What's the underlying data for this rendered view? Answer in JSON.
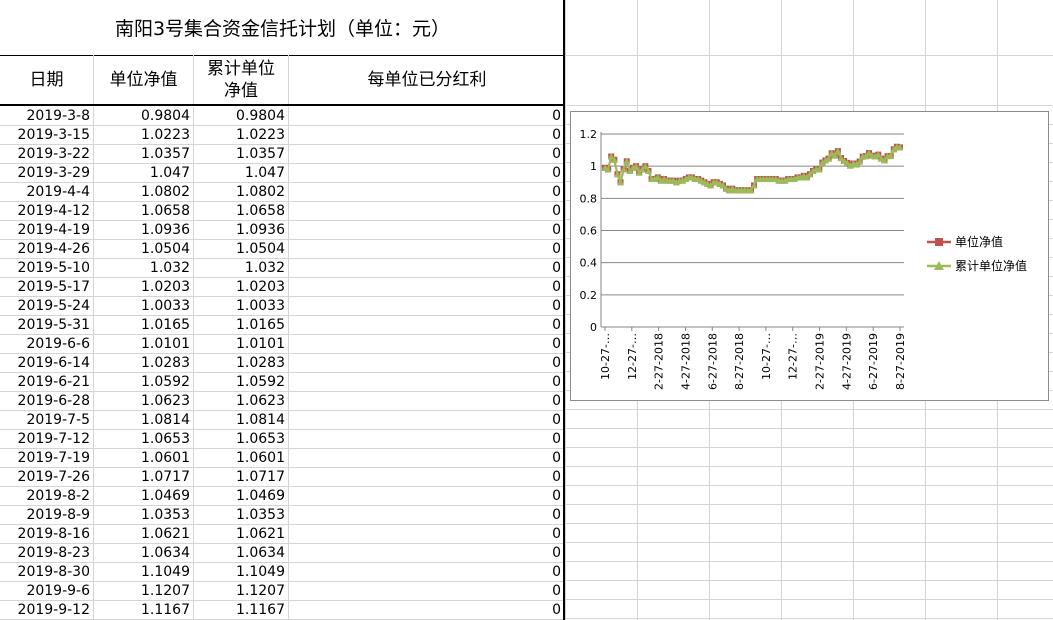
{
  "sheet": {
    "title": "南阳3号集合资金信托计划（单位：元）",
    "headers": {
      "date": "日期",
      "unit_nav": "单位净值",
      "cum_nav_line1": "累计单位",
      "cum_nav_line2": "净值",
      "dividend": "每单位已分红利"
    },
    "rows": [
      {
        "date": "2019-3-8",
        "nav": "0.9804",
        "cum": "0.9804",
        "div": "0"
      },
      {
        "date": "2019-3-15",
        "nav": "1.0223",
        "cum": "1.0223",
        "div": "0"
      },
      {
        "date": "2019-3-22",
        "nav": "1.0357",
        "cum": "1.0357",
        "div": "0"
      },
      {
        "date": "2019-3-29",
        "nav": "1.047",
        "cum": "1.047",
        "div": "0"
      },
      {
        "date": "2019-4-4",
        "nav": "1.0802",
        "cum": "1.0802",
        "div": "0"
      },
      {
        "date": "2019-4-12",
        "nav": "1.0658",
        "cum": "1.0658",
        "div": "0"
      },
      {
        "date": "2019-4-19",
        "nav": "1.0936",
        "cum": "1.0936",
        "div": "0"
      },
      {
        "date": "2019-4-26",
        "nav": "1.0504",
        "cum": "1.0504",
        "div": "0"
      },
      {
        "date": "2019-5-10",
        "nav": "1.032",
        "cum": "1.032",
        "div": "0"
      },
      {
        "date": "2019-5-17",
        "nav": "1.0203",
        "cum": "1.0203",
        "div": "0"
      },
      {
        "date": "2019-5-24",
        "nav": "1.0033",
        "cum": "1.0033",
        "div": "0"
      },
      {
        "date": "2019-5-31",
        "nav": "1.0165",
        "cum": "1.0165",
        "div": "0"
      },
      {
        "date": "2019-6-6",
        "nav": "1.0101",
        "cum": "1.0101",
        "div": "0"
      },
      {
        "date": "2019-6-14",
        "nav": "1.0283",
        "cum": "1.0283",
        "div": "0"
      },
      {
        "date": "2019-6-21",
        "nav": "1.0592",
        "cum": "1.0592",
        "div": "0"
      },
      {
        "date": "2019-6-28",
        "nav": "1.0623",
        "cum": "1.0623",
        "div": "0"
      },
      {
        "date": "2019-7-5",
        "nav": "1.0814",
        "cum": "1.0814",
        "div": "0"
      },
      {
        "date": "2019-7-12",
        "nav": "1.0653",
        "cum": "1.0653",
        "div": "0"
      },
      {
        "date": "2019-7-19",
        "nav": "1.0601",
        "cum": "1.0601",
        "div": "0"
      },
      {
        "date": "2019-7-26",
        "nav": "1.0717",
        "cum": "1.0717",
        "div": "0"
      },
      {
        "date": "2019-8-2",
        "nav": "1.0469",
        "cum": "1.0469",
        "div": "0"
      },
      {
        "date": "2019-8-9",
        "nav": "1.0353",
        "cum": "1.0353",
        "div": "0"
      },
      {
        "date": "2019-8-16",
        "nav": "1.0621",
        "cum": "1.0621",
        "div": "0"
      },
      {
        "date": "2019-8-23",
        "nav": "1.0634",
        "cum": "1.0634",
        "div": "0"
      },
      {
        "date": "2019-8-30",
        "nav": "1.1049",
        "cum": "1.1049",
        "div": "0"
      },
      {
        "date": "2019-9-6",
        "nav": "1.1207",
        "cum": "1.1207",
        "div": "0"
      },
      {
        "date": "2019-9-12",
        "nav": "1.1167",
        "cum": "1.1167",
        "div": "0"
      }
    ]
  },
  "chart_data": {
    "type": "line",
    "title": "",
    "xlabel": "",
    "ylabel": "",
    "ylim": [
      0,
      1.2
    ],
    "yticks": [
      "0",
      "0.2",
      "0.4",
      "0.6",
      "0.8",
      "1",
      "1.2"
    ],
    "xtick_labels": [
      "10-27-…",
      "12-27-…",
      "2-27-2018",
      "4-27-2018",
      "6-27-2018",
      "8-27-2018",
      "10-27-…",
      "12-27-…",
      "2-27-2019",
      "4-27-2019",
      "6-27-2019",
      "8-27-2019"
    ],
    "grid": true,
    "legend_position": "right",
    "x": [
      "2017-10-20",
      "2017-10-27",
      "2017-11-03",
      "2017-11-10",
      "2017-11-17",
      "2017-11-24",
      "2017-12-01",
      "2017-12-08",
      "2017-12-15",
      "2017-12-22",
      "2017-12-29",
      "2018-01-05",
      "2018-01-12",
      "2018-01-19",
      "2018-01-26",
      "2018-02-02",
      "2018-02-09",
      "2018-02-23",
      "2018-03-02",
      "2018-03-09",
      "2018-03-16",
      "2018-03-23",
      "2018-03-30",
      "2018-04-04",
      "2018-04-13",
      "2018-04-20",
      "2018-04-27",
      "2018-05-04",
      "2018-05-11",
      "2018-05-18",
      "2018-05-25",
      "2018-06-01",
      "2018-06-08",
      "2018-06-15",
      "2018-06-22",
      "2018-06-29",
      "2018-07-06",
      "2018-07-13",
      "2018-07-20",
      "2018-07-27",
      "2018-08-03",
      "2018-08-10",
      "2018-08-17",
      "2018-08-24",
      "2018-08-31",
      "2018-09-07",
      "2018-09-14",
      "2018-09-21",
      "2018-09-28",
      "2018-10-12",
      "2018-10-19",
      "2018-10-26",
      "2018-11-02",
      "2018-11-09",
      "2018-11-16",
      "2018-11-23",
      "2018-11-30",
      "2018-12-07",
      "2018-12-14",
      "2018-12-21",
      "2018-12-28",
      "2019-01-04",
      "2019-01-11",
      "2019-01-18",
      "2019-01-25",
      "2019-02-01",
      "2019-02-15",
      "2019-02-22",
      "2019-03-01",
      "2019-03-08",
      "2019-03-15",
      "2019-03-22",
      "2019-03-29",
      "2019-04-04",
      "2019-04-12",
      "2019-04-19",
      "2019-04-26",
      "2019-05-10",
      "2019-05-17",
      "2019-05-24",
      "2019-05-31",
      "2019-06-06",
      "2019-06-14",
      "2019-06-21",
      "2019-06-28",
      "2019-07-05",
      "2019-07-12",
      "2019-07-19",
      "2019-07-26",
      "2019-08-02",
      "2019-08-09",
      "2019-08-16",
      "2019-08-23",
      "2019-08-30",
      "2019-09-06",
      "2019-09-12"
    ],
    "series": [
      {
        "name": "单位净值",
        "color": "#c0504d",
        "marker": "square",
        "values": [
          0.99,
          0.98,
          1.06,
          1.04,
          0.95,
          0.9,
          0.98,
          1.03,
          0.97,
          0.99,
          1.0,
          0.96,
          0.98,
          1.0,
          0.97,
          0.92,
          0.92,
          0.93,
          0.91,
          0.92,
          0.91,
          0.91,
          0.91,
          0.9,
          0.91,
          0.91,
          0.92,
          0.93,
          0.93,
          0.92,
          0.92,
          0.91,
          0.9,
          0.89,
          0.88,
          0.9,
          0.9,
          0.89,
          0.88,
          0.86,
          0.85,
          0.86,
          0.85,
          0.85,
          0.85,
          0.85,
          0.85,
          0.85,
          0.88,
          0.92,
          0.92,
          0.92,
          0.92,
          0.92,
          0.92,
          0.92,
          0.91,
          0.91,
          0.91,
          0.92,
          0.92,
          0.92,
          0.93,
          0.93,
          0.94,
          0.93,
          0.95,
          0.97,
          0.98,
          0.9804,
          1.0223,
          1.0357,
          1.047,
          1.0802,
          1.0658,
          1.0936,
          1.0504,
          1.032,
          1.0203,
          1.0033,
          1.0165,
          1.0101,
          1.0283,
          1.0592,
          1.0623,
          1.0814,
          1.0653,
          1.0601,
          1.0717,
          1.0469,
          1.0353,
          1.0621,
          1.0634,
          1.1049,
          1.1207,
          1.1167
        ]
      },
      {
        "name": "累计单位净值",
        "color": "#9bbb59",
        "marker": "triangle",
        "values": [
          0.99,
          0.98,
          1.06,
          1.04,
          0.95,
          0.9,
          0.98,
          1.03,
          0.97,
          0.99,
          1.0,
          0.96,
          0.98,
          1.0,
          0.97,
          0.92,
          0.92,
          0.93,
          0.91,
          0.92,
          0.91,
          0.91,
          0.91,
          0.9,
          0.91,
          0.91,
          0.92,
          0.93,
          0.93,
          0.92,
          0.92,
          0.91,
          0.9,
          0.89,
          0.88,
          0.9,
          0.9,
          0.89,
          0.88,
          0.86,
          0.85,
          0.86,
          0.85,
          0.85,
          0.85,
          0.85,
          0.85,
          0.85,
          0.88,
          0.92,
          0.92,
          0.92,
          0.92,
          0.92,
          0.92,
          0.92,
          0.91,
          0.91,
          0.91,
          0.92,
          0.92,
          0.92,
          0.93,
          0.93,
          0.94,
          0.93,
          0.95,
          0.97,
          0.98,
          0.9804,
          1.0223,
          1.0357,
          1.047,
          1.0802,
          1.0658,
          1.0936,
          1.0504,
          1.032,
          1.0203,
          1.0033,
          1.0165,
          1.0101,
          1.0283,
          1.0592,
          1.0623,
          1.0814,
          1.0653,
          1.0601,
          1.0717,
          1.0469,
          1.0353,
          1.0621,
          1.0634,
          1.1049,
          1.1207,
          1.1167
        ]
      }
    ]
  }
}
